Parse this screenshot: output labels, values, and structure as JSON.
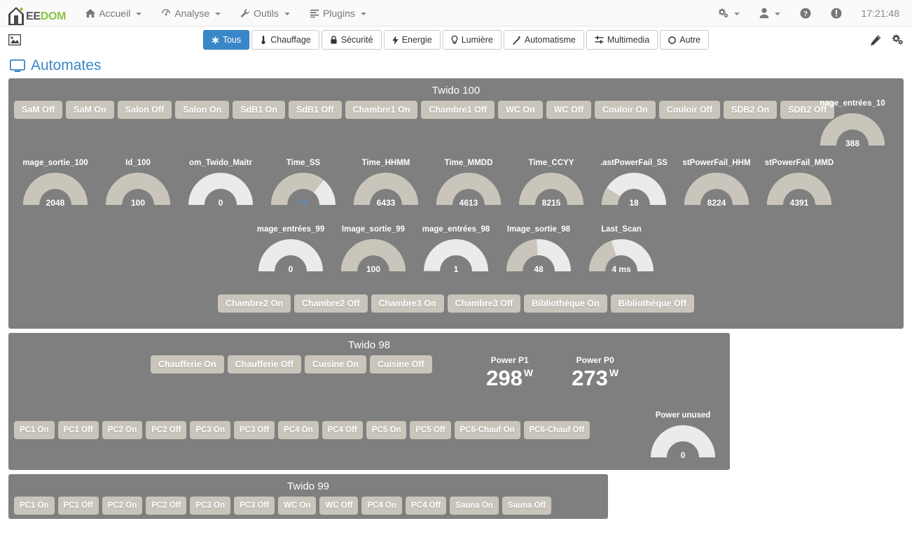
{
  "navbar": {
    "brand": {
      "ee": "EE",
      "dom": "DOM",
      "icon": "house-logo-icon"
    },
    "items": [
      {
        "label": "Accueil",
        "icon": "home-icon",
        "caret": true
      },
      {
        "label": "Analyse",
        "icon": "gauge-icon",
        "caret": true
      },
      {
        "label": "Outils",
        "icon": "wrench-icon",
        "caret": true
      },
      {
        "label": "Plugins",
        "icon": "list-icon",
        "caret": true
      }
    ],
    "right": [
      {
        "name": "gears-icon",
        "caret": true
      },
      {
        "name": "user-icon",
        "caret": true
      },
      {
        "name": "help-icon",
        "caret": false
      },
      {
        "name": "info-icon",
        "caret": false
      }
    ],
    "clock": "17:21:48"
  },
  "filterbar": {
    "image_icon": "image-icon",
    "buttons": [
      {
        "label": "Tous",
        "icon": "asterisk-icon",
        "active": true
      },
      {
        "label": "Chauffage",
        "icon": "thermometer-icon",
        "active": false
      },
      {
        "label": "Sécurité",
        "icon": "lock-icon",
        "active": false
      },
      {
        "label": "Energie",
        "icon": "bolt-icon",
        "active": false
      },
      {
        "label": "Lumière",
        "icon": "bulb-icon",
        "active": false
      },
      {
        "label": "Automatisme",
        "icon": "wand-icon",
        "active": false
      },
      {
        "label": "Multimedia",
        "icon": "sliders-icon",
        "active": false
      },
      {
        "label": "Autre",
        "icon": "circle-icon",
        "active": false
      }
    ],
    "edit_icons": [
      {
        "name": "pencil-icon"
      },
      {
        "name": "gears-config-icon"
      }
    ]
  },
  "page": {
    "title": "Automates",
    "title_icon": "monitor-icon"
  },
  "colors": {
    "accent_blue": "#3a87c8",
    "brand_green": "#8bc43f",
    "panel_gray": "#7f7f7f",
    "button_tan": "#c9c5bb",
    "gauge_fill": "#c9c5bb",
    "gauge_empty": "#ebebeb"
  },
  "panels": [
    {
      "title": "Twido 100",
      "row1_buttons": [
        "SaM Off",
        "SaM On",
        "Salon Off",
        "Salon On",
        "SdB1 On",
        "SdB1 Off",
        "Chambre1 On",
        "Chambre1 Off",
        "WC On",
        "WC Off",
        "Couloir On",
        "Couloir Off",
        "SDB2 On",
        "SDB2 Off"
      ],
      "corner_gauge": {
        "label": "nage_entrées_10",
        "value": "388",
        "percent": 100
      },
      "gauges_row1": [
        {
          "label": "mage_sortie_100",
          "value": "2048",
          "percent": 100
        },
        {
          "label": "Id_100",
          "value": "100",
          "percent": 100
        },
        {
          "label": "om_Twido_Maitr",
          "value": "0",
          "percent": 0
        },
        {
          "label": "Time_SS",
          "value": "72",
          "percent": 72,
          "blue": true
        },
        {
          "label": "Time_HHMM",
          "value": "6433",
          "percent": 100
        },
        {
          "label": "Time_MMDD",
          "value": "4613",
          "percent": 100
        },
        {
          "label": "Time_CCYY",
          "value": "8215",
          "percent": 100
        },
        {
          "label": ".astPowerFail_SS",
          "value": "18",
          "percent": 18
        },
        {
          "label": "stPowerFail_HHM",
          "value": "8224",
          "percent": 100
        },
        {
          "label": "stPowerFail_MMD",
          "value": "4391",
          "percent": 100
        }
      ],
      "gauges_row2": [
        {
          "label": "mage_entrées_99",
          "value": "0",
          "percent": 0
        },
        {
          "label": "Image_sortie_99",
          "value": "100",
          "percent": 100
        },
        {
          "label": "mage_entrées_98",
          "value": "1",
          "percent": 1
        },
        {
          "label": "Image_sortie_98",
          "value": "48",
          "percent": 48
        },
        {
          "label": "Last_Scan",
          "value": "4 ms",
          "percent": 40
        }
      ],
      "row3_buttons": [
        "Chambre2 On",
        "Chambre2 Off",
        "Chambre3 On",
        "Chambre3 Off",
        "Bibliothèque On",
        "Bibliothèque Off"
      ]
    },
    {
      "title": "Twido 98",
      "row1_buttons": [
        "Chaufferie On",
        "Chaufferie Off",
        "Cuisine On",
        "Cuisine Off"
      ],
      "powers": [
        {
          "label": "Power P1",
          "value": "298",
          "unit": "W"
        },
        {
          "label": "Power P0",
          "value": "273",
          "unit": "W"
        }
      ],
      "row2_buttons": [
        "PC1 On",
        "PC1 Off",
        "PC2 On",
        "PC2 Off",
        "PC3 On",
        "PC3 Off",
        "PC4 On",
        "PC4 Off",
        "PC5 On",
        "PC5 Off",
        "PC6-Chauf On",
        "PC6-Chauf Off"
      ],
      "gauge": {
        "label": "Power unused",
        "value": "0",
        "percent": 0
      }
    },
    {
      "title": "Twido 99",
      "row1_buttons": [
        "PC1 On",
        "PC1 Off",
        "PC2 On",
        "PC2 Off",
        "PC3 On",
        "PC3 Off",
        "WC On",
        "WC Off",
        "PC4 On",
        "PC4 Off",
        "Sauna On",
        "Sauna Off"
      ]
    }
  ]
}
